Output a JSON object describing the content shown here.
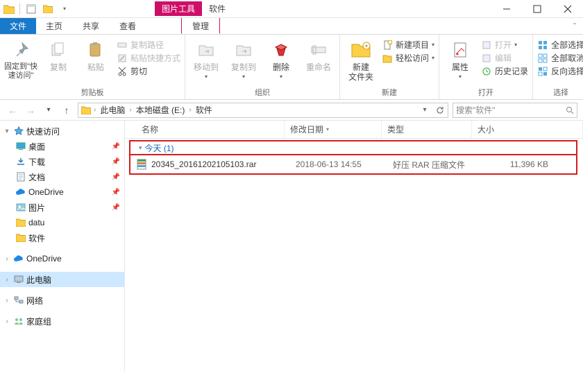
{
  "titlebar": {
    "tool_tab": "图片工具",
    "tool_side": "软件"
  },
  "tabs": {
    "file": "文件",
    "home": "主页",
    "share": "共享",
    "view": "查看",
    "manage": "管理"
  },
  "ribbon": {
    "clipboard": {
      "pin": "固定到\"快速访问\"",
      "copy": "复制",
      "paste": "粘贴",
      "copy_path": "复制路径",
      "paste_shortcut": "粘贴快捷方式",
      "cut": "剪切",
      "group": "剪贴板"
    },
    "organize": {
      "moveto": "移动到",
      "copyto": "复制到",
      "delete": "删除",
      "rename": "重命名",
      "group": "组织"
    },
    "new": {
      "folder": "新建\n文件夹",
      "new_item": "新建项目",
      "easy_access": "轻松访问",
      "group": "新建"
    },
    "open": {
      "properties": "属性",
      "open": "打开",
      "edit": "编辑",
      "history": "历史记录",
      "group": "打开"
    },
    "select": {
      "select_all": "全部选择",
      "select_none": "全部取消",
      "invert": "反向选择",
      "group": "选择"
    }
  },
  "breadcrumb": {
    "items": [
      "此电脑",
      "本地磁盘 (E:)",
      "软件"
    ]
  },
  "search": {
    "placeholder": "搜索\"软件\""
  },
  "nav": {
    "quick": "快速访问",
    "desktop": "桌面",
    "downloads": "下载",
    "documents": "文档",
    "onedrive": "OneDrive",
    "pictures": "图片",
    "datu": "datu",
    "software": "软件",
    "onedrive2": "OneDrive",
    "thispc": "此电脑",
    "network": "网络",
    "homegroup": "家庭组"
  },
  "columns": {
    "name": "名称",
    "date": "修改日期",
    "type": "类型",
    "size": "大小"
  },
  "group_header": "今天 (1)",
  "file": {
    "name": "20345_20161202105103.rar",
    "date": "2018-06-13 14:55",
    "type": "好压 RAR 压缩文件",
    "size": "11,396 KB"
  }
}
